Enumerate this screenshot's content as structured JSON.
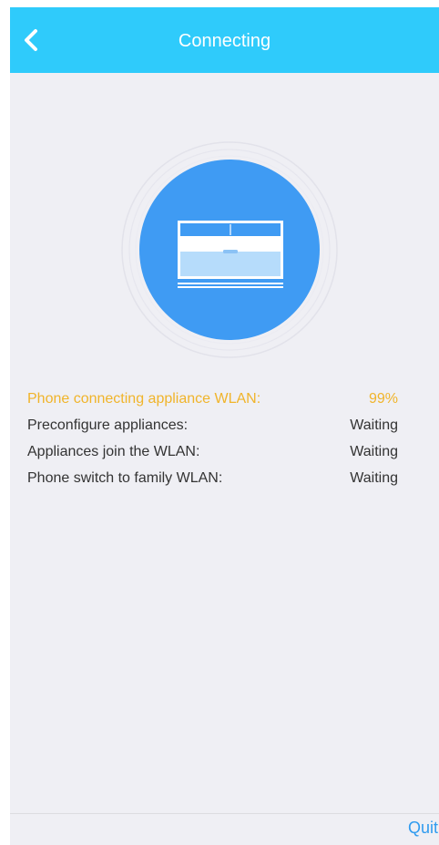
{
  "header": {
    "title": "Connecting",
    "background_color": "#2fcbfb",
    "back_icon": "chevron-left-icon"
  },
  "hero": {
    "icon": "air-conditioner-icon",
    "circle_color": "#3f9bf3"
  },
  "steps": [
    {
      "label": "Phone connecting appliance WLAN:",
      "status": "99%",
      "active": true
    },
    {
      "label": "Preconfigure appliances:",
      "status": "Waiting",
      "active": false
    },
    {
      "label": "Appliances join the WLAN:",
      "status": "Waiting",
      "active": false
    },
    {
      "label": "Phone switch to family WLAN:",
      "status": "Waiting",
      "active": false
    }
  ],
  "colors": {
    "active_step": "#f0b42a",
    "normal_step": "#333333",
    "quit": "#2f9bef"
  },
  "footer": {
    "quit_label": "Quit"
  }
}
